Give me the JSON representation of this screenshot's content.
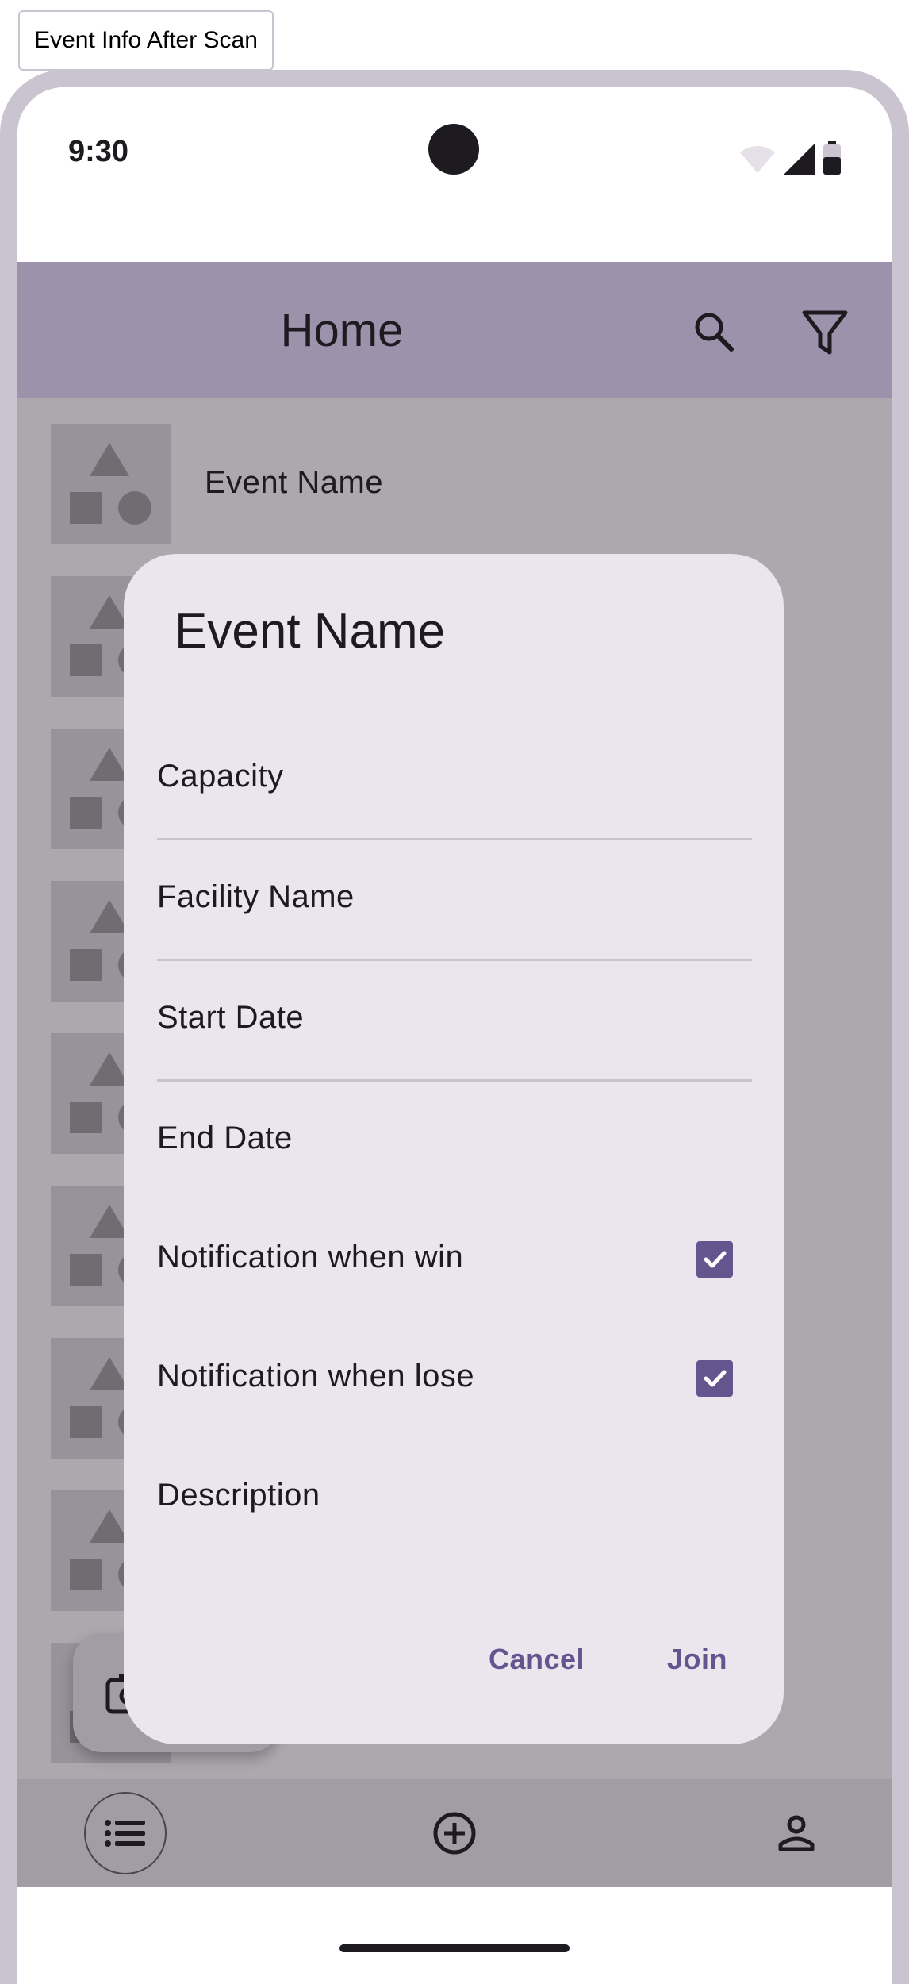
{
  "frame_label": "Event Info After Scan",
  "status_bar": {
    "time": "9:30"
  },
  "top_bar": {
    "title": "Home",
    "search_icon": "search-icon",
    "filter_icon": "filter-icon"
  },
  "list": {
    "first_item_label": "Event Name"
  },
  "fab": {
    "icon": "camera-icon"
  },
  "dialog": {
    "title": "Event Name",
    "capacity_label": "Capacity",
    "facility_label": "Facility Name",
    "start_date_label": "Start Date",
    "end_date_label": "End Date",
    "notify_win_label": "Notification when win",
    "notify_win_checked": true,
    "notify_lose_label": "Notification when lose",
    "notify_lose_checked": true,
    "description_label": "Description",
    "cancel_label": "Cancel",
    "join_label": "Join"
  },
  "bottom_nav": {
    "items": [
      {
        "icon": "list-icon",
        "active": true
      },
      {
        "icon": "add-circle-icon",
        "active": false
      },
      {
        "icon": "person-icon",
        "active": false
      }
    ]
  },
  "colors": {
    "top_bar": "#9d92ab",
    "scrim": "#ada8ae",
    "dialog_surface": "#ebe5ee",
    "accent": "#65558f",
    "frame": "#cac4d0"
  }
}
